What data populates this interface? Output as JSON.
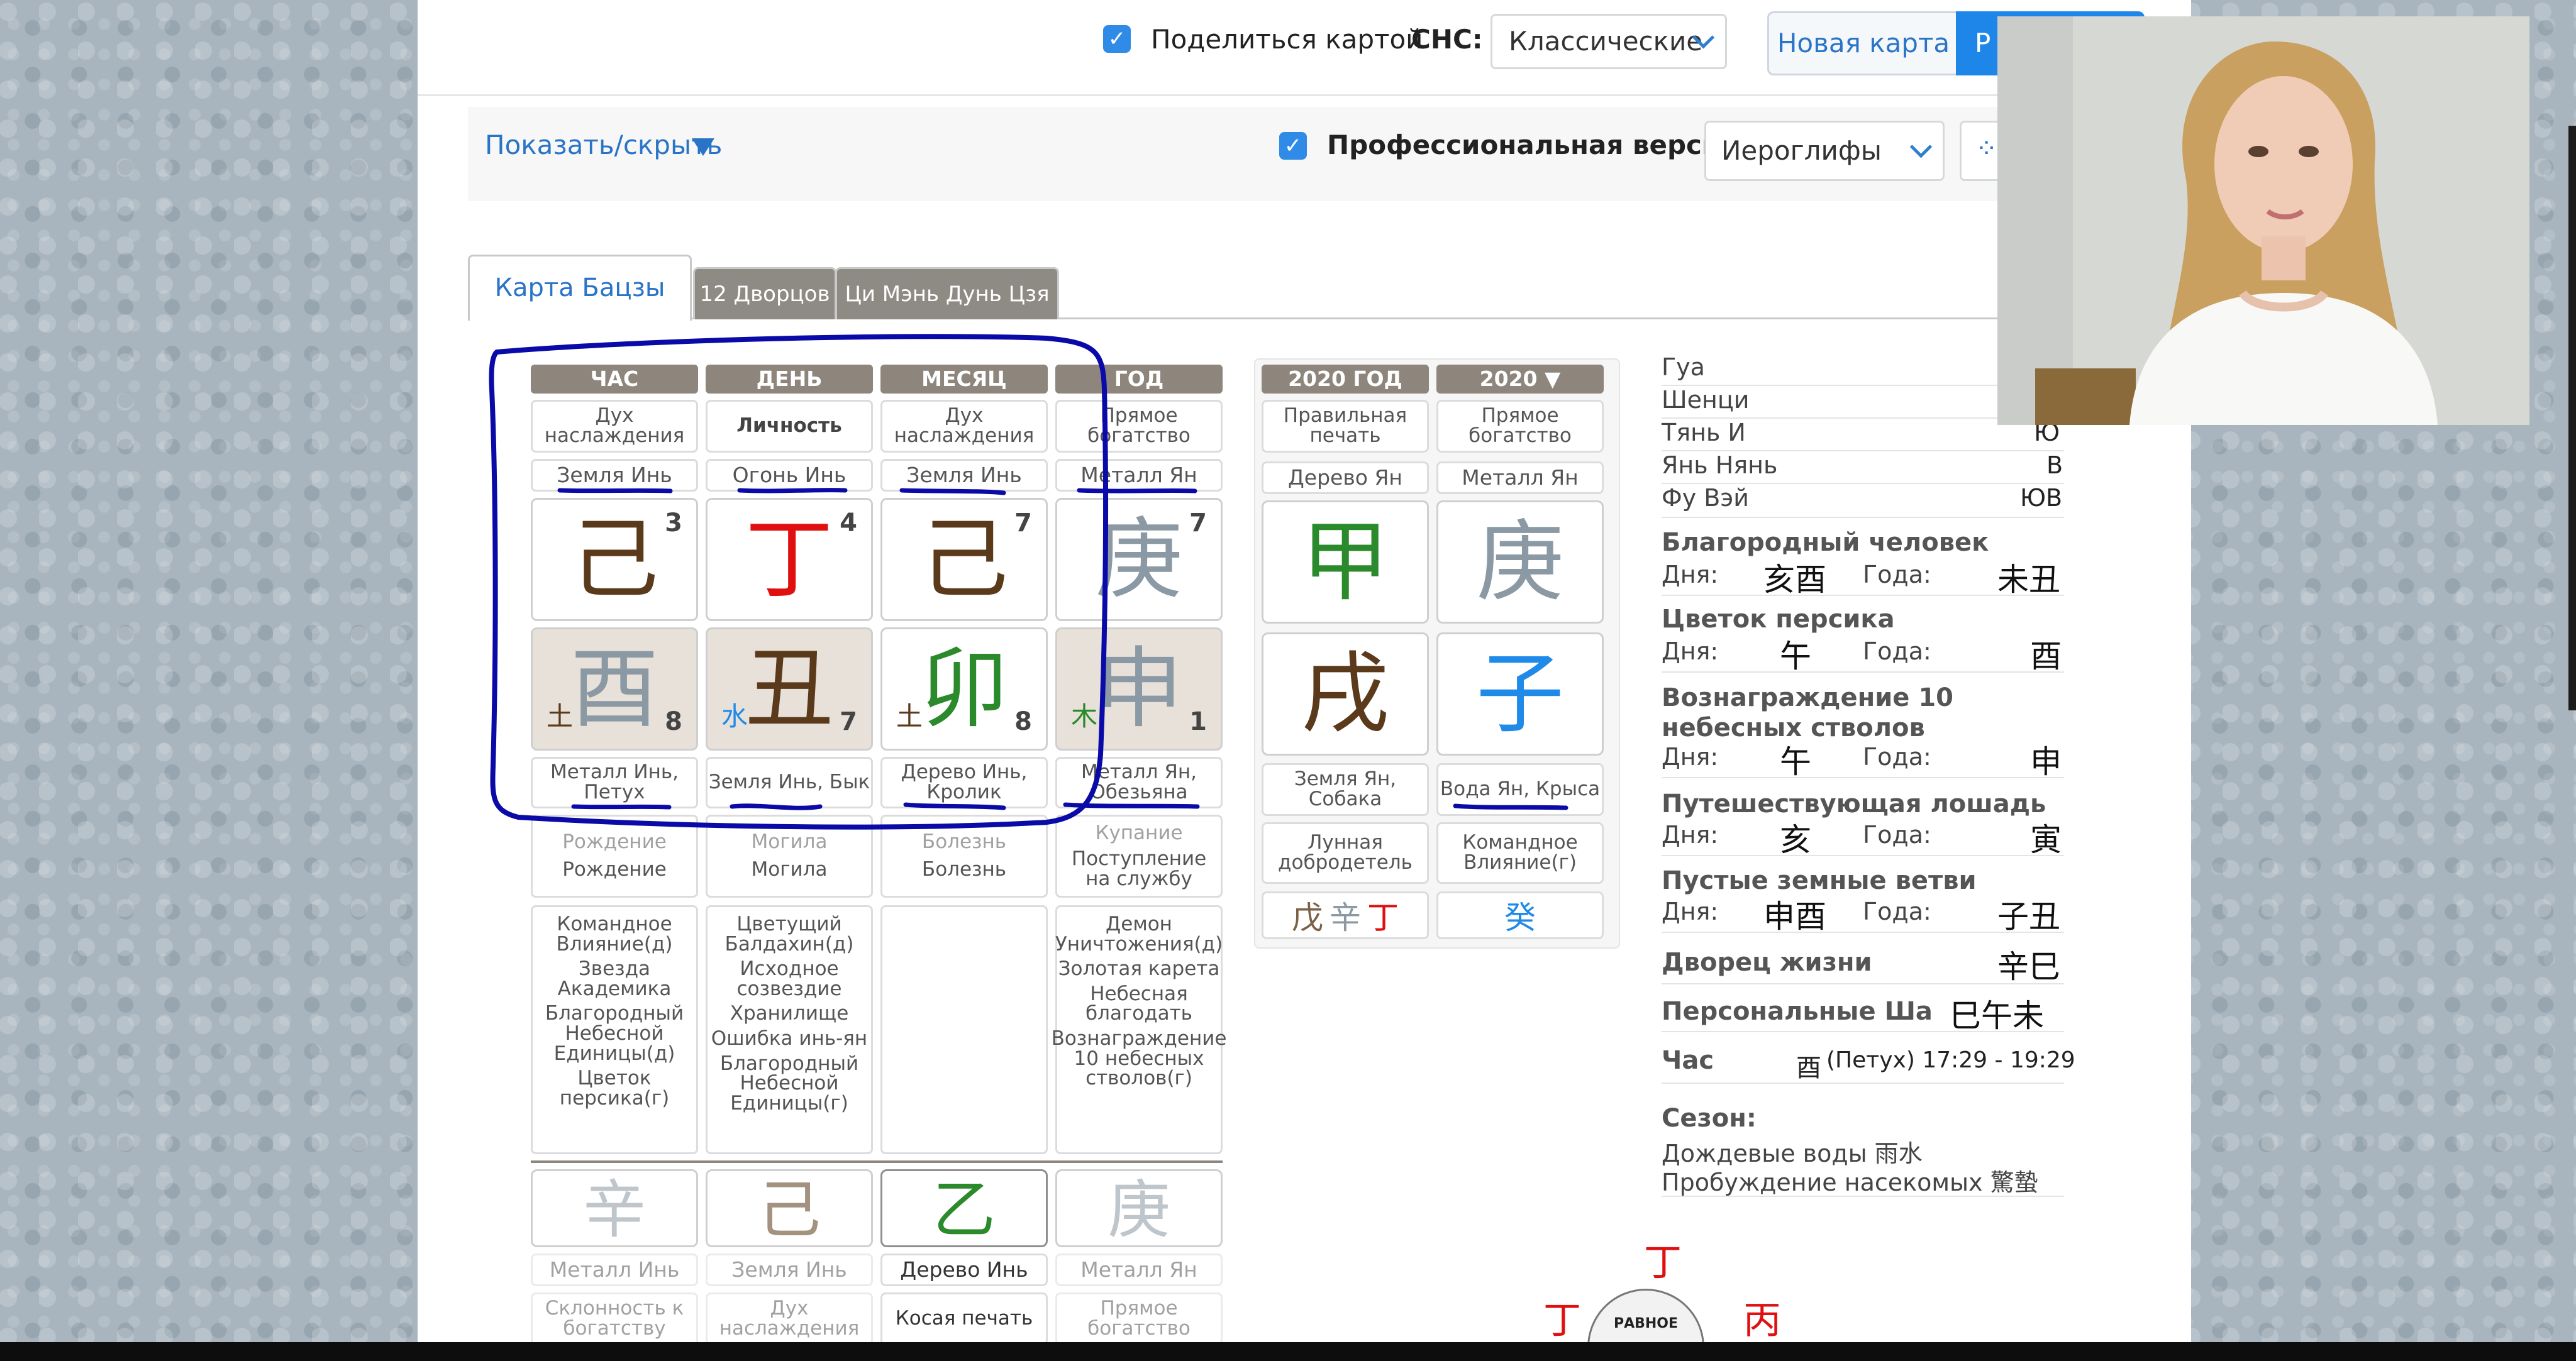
{
  "topbar": {
    "share_label": "Поделиться картой",
    "sns_label": "СНС:",
    "sns_value": "Классические",
    "new_map": "Новая карта",
    "blue_btn": "Р"
  },
  "toolbar2": {
    "show_hide": "Показать/скрыть",
    "pro_label": "Профессиональная версия",
    "script_value": "Иероглифы",
    "clipped_btn": "⁘"
  },
  "tabs": [
    "Карта Бацзы",
    "12 Дворцов",
    "Ци Мэнь Дунь Цзя"
  ],
  "pillars": [
    {
      "hdr": "ЧАС",
      "star": "Дух наслаждения",
      "stem_el": "Земля Инь",
      "stem": "己",
      "stem_num": "3",
      "branch": "酉",
      "branch_sub": "土",
      "branch_num": "8",
      "branch_desc": "Металл Инь, Петух",
      "life1": "Рождение",
      "life2": "Рождение",
      "symbols": [
        "Командное Влияние(д)",
        "Звезда Академика",
        "Благородный Небесной Единицы(д)",
        "Цветок персика(г)"
      ],
      "hidden": "辛",
      "hidden_el": "Металл Инь",
      "hidden_star": "Склонность к богатству"
    },
    {
      "hdr": "ДЕНЬ",
      "star": "Личность",
      "stem_el": "Огонь Инь",
      "stem": "丁",
      "stem_num": "4",
      "branch": "丑",
      "branch_sub": "水",
      "branch_num": "7",
      "branch_desc": "Земля Инь, Бык",
      "life1": "Могила",
      "life2": "Могила",
      "symbols": [
        "Цветущий Балдахин(д)",
        "Исходное созвездие",
        "Хранилище",
        "Ошибка инь-ян",
        "Благородный Небесной Единицы(г)"
      ],
      "hidden": "己",
      "hidden_el": "Земля Инь",
      "hidden_star": "Дух наслаждения"
    },
    {
      "hdr": "МЕСЯЦ",
      "star": "Дух наслаждения",
      "stem_el": "Земля Инь",
      "stem": "己",
      "stem_num": "7",
      "branch": "卯",
      "branch_sub": "土",
      "branch_num": "8",
      "branch_desc": "Дерево Инь, Кролик",
      "life1": "Болезнь",
      "life2": "Болезнь",
      "symbols": [],
      "hidden": "乙",
      "hidden_el": "Дерево Инь",
      "hidden_star": "Косая печать"
    },
    {
      "hdr": "ГОД",
      "star": "Прямое богатство",
      "stem_el": "Металл Ян",
      "stem": "庚",
      "stem_num": "7",
      "branch": "申",
      "branch_sub": "木",
      "branch_num": "1",
      "branch_desc": "Металл Ян, Обезьяна",
      "life1": "Купание",
      "life2": "Поступление на службу",
      "symbols": [
        "Демон Уничтожения(д)",
        "Золотая карета",
        "Небесная благодать",
        "Вознаграждение 10 небесных стволов(г)"
      ],
      "hidden": "庚",
      "hidden_el": "Металл Ян",
      "hidden_star": "Прямое богатство"
    }
  ],
  "luck": [
    {
      "hdr": "2020 ГОД",
      "star": "Правильная печать",
      "stem_el": "Дерево Ян",
      "stem": "甲",
      "branch": "戌",
      "branch_desc": "Земля Ян, Собака",
      "symbol": "Лунная добродетель",
      "hidden": [
        "戊",
        "辛",
        "丁"
      ]
    },
    {
      "hdr": "2020 ▼",
      "star": "Прямое богатство",
      "stem_el": "Металл Ян",
      "stem": "庚",
      "branch": "子",
      "branch_desc": "Вода Ян, Крыса",
      "symbol": "Командное Влияние(г)",
      "hidden": [
        "癸"
      ]
    }
  ],
  "info": {
    "gua": "Гуа",
    "shenci": "Шенци",
    "tian_i": "Тянь И",
    "tian_i_v": "Ю",
    "yan_nian": "Янь Нянь",
    "yan_nian_v": "В",
    "fu_wei": "Фу Вэй",
    "fu_wei_v": "ЮВ",
    "day": "Дня:",
    "year": "Года:",
    "noble": "Благородный человек",
    "noble_d": "亥酉",
    "noble_y": "未丑",
    "peach": "Цветок персика",
    "peach_d": "午",
    "peach_y": "酉",
    "reward": "Вознаграждение 10 небесных стволов",
    "reward_d": "午",
    "reward_y": "申",
    "horse": "Путешествующая лошадь",
    "horse_d": "亥",
    "horse_y": "寅",
    "empty": "Пустые земные ветви",
    "empty_d": "申酉",
    "empty_y": "子丑",
    "palace": "Дворец жизни",
    "palace_v": "辛巳",
    "sha": "Персональные Ша",
    "sha_v": "巳午未",
    "hour": "Час",
    "hour_v_ch": "酉",
    "hour_v": "(Петух) 17:29 - 19:29",
    "season": "Сезон:",
    "season1": "Дождевые воды 雨水",
    "season2": "Пробуждение насекомых 驚蟄"
  },
  "bottom": {
    "ding_top": "丁",
    "ding_left": "丁",
    "bing_right": "丙",
    "circle_label": "РАВНОЕ"
  },
  "colors": {
    "accent": "#1e86e8",
    "header": "#8e867d",
    "annotation": "#0a0aa8",
    "earth": "#5a3a1a",
    "fire": "#e01010",
    "wood": "#2b8a2b",
    "metal": "#8a99a3",
    "water": "#1f8ae8"
  }
}
